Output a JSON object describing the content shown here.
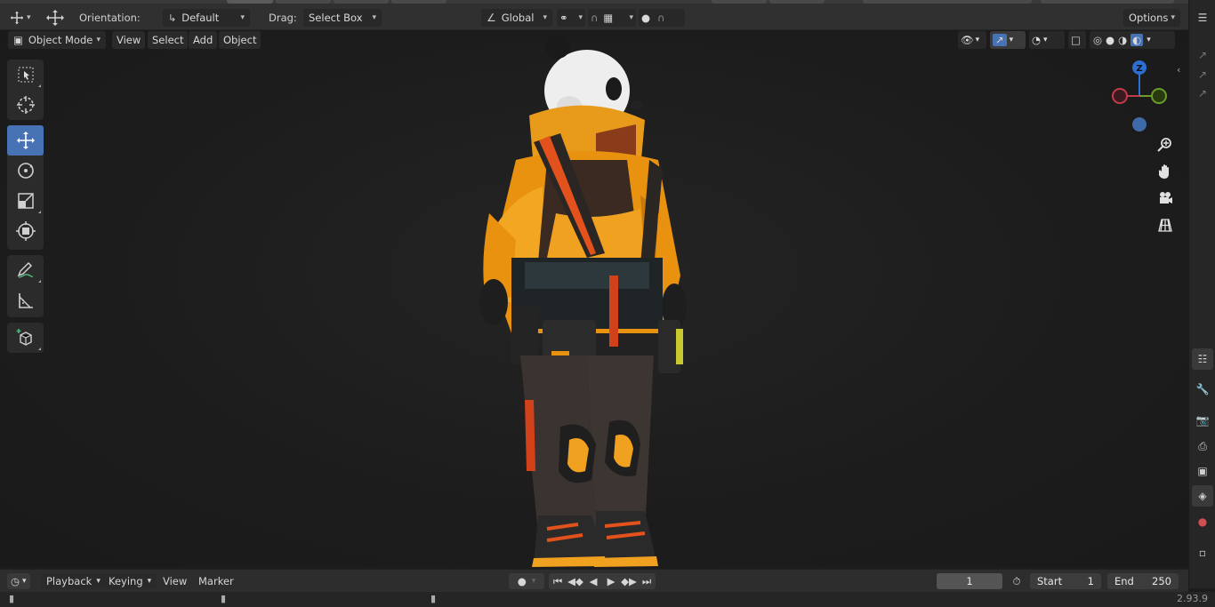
{
  "header": {
    "orientation_label": "Orientation:",
    "orientation_value": "Default",
    "drag_label": "Drag:",
    "drag_value": "Select Box",
    "transform_space": "Global",
    "options_label": "Options"
  },
  "menu": {
    "mode": "Object Mode",
    "view": "View",
    "select": "Select",
    "add": "Add",
    "object": "Object"
  },
  "gizmo": {
    "z_label": "Z",
    "x_color": "#c2394d",
    "y_color": "#6a9c26",
    "z_color": "#2c6fd1",
    "neg_z_color": "#3e6aa8"
  },
  "timeline": {
    "playback": "Playback",
    "keying": "Keying",
    "view": "View",
    "marker": "Marker",
    "current_frame": "1",
    "start_label": "Start",
    "start_value": "1",
    "end_label": "End",
    "end_value": "250"
  },
  "status": {
    "version": "2.93.9"
  },
  "colors": {
    "accent": "#4772b3",
    "header_bg": "#303030",
    "viewport_bg": "#1d1d1d"
  }
}
